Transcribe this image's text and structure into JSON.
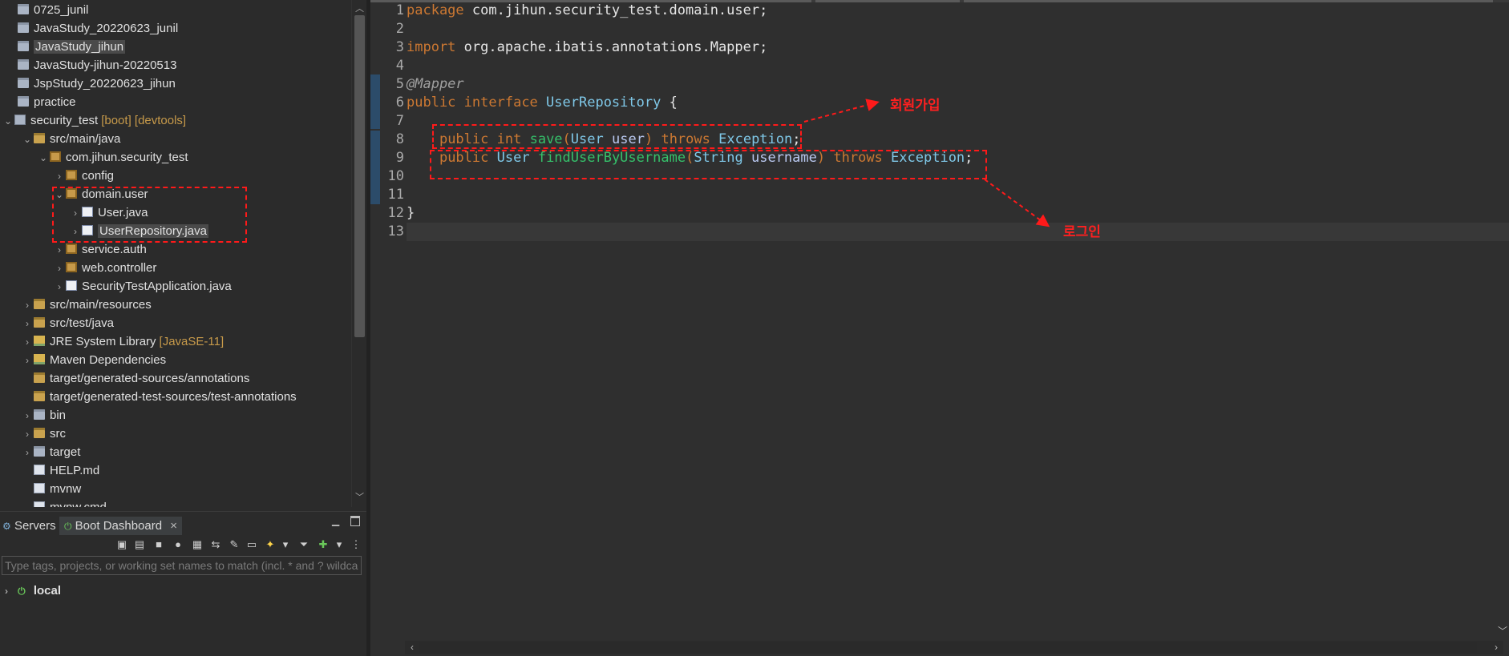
{
  "explorer": {
    "items": [
      {
        "label": "0725_junil",
        "icon": "folder-icon"
      },
      {
        "label": "JavaStudy_20220623_junil",
        "icon": "folder-icon"
      },
      {
        "label": "JavaStudy_jihun",
        "icon": "folder-icon"
      },
      {
        "label": "JavaStudy-jihun-20220513",
        "icon": "folder-icon"
      },
      {
        "label": "JspStudy_20220623_jihun",
        "icon": "folder-icon"
      },
      {
        "label": "practice",
        "icon": "folder-icon"
      },
      {
        "label": "security_test",
        "decoration": "[boot] [devtools]",
        "icon": "project-icon"
      },
      {
        "label": "src/main/java",
        "icon": "source-folder-icon"
      },
      {
        "label": "com.jihun.security_test",
        "icon": "package-icon"
      },
      {
        "label": "config",
        "icon": "package-icon"
      },
      {
        "label": "domain.user",
        "icon": "package-icon"
      },
      {
        "label": "User.java",
        "icon": "java-file-icon"
      },
      {
        "label": "UserRepository.java",
        "icon": "java-file-icon"
      },
      {
        "label": "service.auth",
        "icon": "package-icon"
      },
      {
        "label": "web.controller",
        "icon": "package-icon"
      },
      {
        "label": "SecurityTestApplication.java",
        "icon": "java-file-icon"
      },
      {
        "label": "src/main/resources",
        "icon": "source-folder-icon"
      },
      {
        "label": "src/test/java",
        "icon": "source-folder-icon"
      },
      {
        "label": "JRE System Library",
        "decoration": "[JavaSE-11]",
        "icon": "library-icon"
      },
      {
        "label": "Maven Dependencies",
        "icon": "library-icon"
      },
      {
        "label": "target/generated-sources/annotations",
        "icon": "source-folder-icon"
      },
      {
        "label": "target/generated-test-sources/test-annotations",
        "icon": "source-folder-icon"
      },
      {
        "label": "bin",
        "icon": "folder-icon"
      },
      {
        "label": "src",
        "icon": "source-folder-icon"
      },
      {
        "label": "target",
        "icon": "folder-icon"
      },
      {
        "label": "HELP.md",
        "icon": "file-icon"
      },
      {
        "label": "mvnw",
        "icon": "file-icon"
      },
      {
        "label": "mvnw.cmd",
        "icon": "file-icon"
      }
    ]
  },
  "panel": {
    "tabs": [
      {
        "label": "Servers"
      },
      {
        "label": "Boot Dashboard",
        "active": true
      }
    ],
    "search_placeholder": "Type tags, projects, or working set names to match (incl. * and ? wildcards)",
    "local_label": "local"
  },
  "editor": {
    "line_numbers": [
      "1",
      "2",
      "3",
      "4",
      "5",
      "6",
      "7",
      "8",
      "9",
      "10",
      "11",
      "12",
      "13"
    ],
    "lines": {
      "l1_kw": "package",
      "l1_rest": " com.jihun.security_test.domain.user;",
      "l3_kw": "import",
      "l3_rest": " org.apache.ibatis.annotations.Mapper;",
      "l5_ann": "@Mapper",
      "l6_kw1": "public",
      "l6_kw2": "interface",
      "l6_name": "UserRepository",
      "l6_rest": " {",
      "l8_kw1": "public",
      "l8_kw2": "int",
      "l8_fn": "save",
      "l8_p1": "(",
      "l8_ty": "User",
      "l8_pn": "user",
      "l8_p2": ")",
      "l8_kw3": "throws",
      "l8_ex": "Exception",
      "l8_end": ";",
      "l9_kw1": "public",
      "l9_ty": "User",
      "l9_fn": "findUserByUsername",
      "l9_p1": "(",
      "l9_ty2": "String",
      "l9_pn": "username",
      "l9_p2": ")",
      "l9_kw3": "throws",
      "l9_ex": "Exception",
      "l9_end": ";",
      "l12": "}"
    }
  },
  "annotations": {
    "signup": "회원가입",
    "login": "로그인"
  },
  "colors": {
    "keyword": "#cc7832",
    "type": "#7fc8e8",
    "method": "#35c06a",
    "annotation_red": "#ff1a1a"
  }
}
